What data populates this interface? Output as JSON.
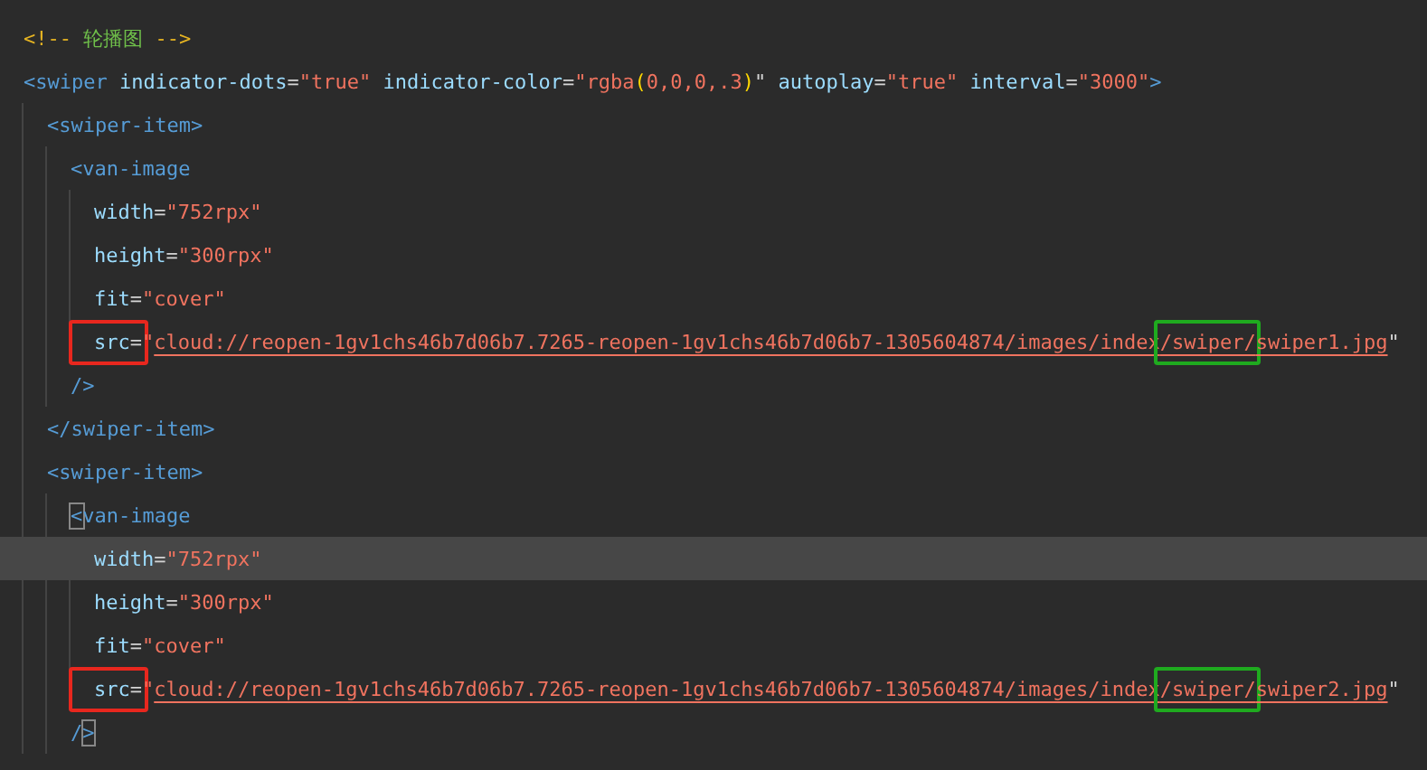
{
  "editor": {
    "lines": [
      {
        "current": false,
        "tokens": [
          {
            "kind": "comment_punct",
            "text": "<!-- "
          },
          {
            "kind": "comment",
            "text": "轮播图"
          },
          {
            "kind": "comment_punct",
            "text": " -->"
          }
        ]
      },
      {
        "current": false,
        "tokens": [
          {
            "kind": "tag",
            "text": "<swiper"
          },
          {
            "kind": "attr",
            "text": " indicator-dots"
          },
          {
            "kind": "punct",
            "text": "="
          },
          {
            "kind": "string",
            "text": "\"true\""
          },
          {
            "kind": "attr",
            "text": " indicator-color"
          },
          {
            "kind": "punct",
            "text": "="
          },
          {
            "kind": "string",
            "text": "\"rgba"
          },
          {
            "kind": "paren",
            "text": "("
          },
          {
            "kind": "string",
            "text": "0,0,0,.3"
          },
          {
            "kind": "paren",
            "text": ")"
          },
          {
            "kind": "punct",
            "text": "\""
          },
          {
            "kind": "attr",
            "text": " autoplay"
          },
          {
            "kind": "punct",
            "text": "="
          },
          {
            "kind": "string",
            "text": "\"true\""
          },
          {
            "kind": "attr",
            "text": " interval"
          },
          {
            "kind": "punct",
            "text": "="
          },
          {
            "kind": "string",
            "text": "\"3000\""
          },
          {
            "kind": "tag",
            "text": ">"
          }
        ],
        "children": [
          {
            "current": false,
            "tokens": [
              {
                "kind": "tag",
                "text": "<swiper-item>"
              }
            ],
            "children": [
              {
                "current": false,
                "tokens": [
                  {
                    "kind": "tag",
                    "text": "<van-image"
                  }
                ],
                "children": [
                  {
                    "current": false,
                    "tokens": [
                      {
                        "kind": "attr",
                        "text": "width"
                      },
                      {
                        "kind": "punct",
                        "text": "="
                      },
                      {
                        "kind": "string",
                        "text": "\"752rpx\""
                      }
                    ]
                  },
                  {
                    "current": false,
                    "tokens": [
                      {
                        "kind": "attr",
                        "text": "height"
                      },
                      {
                        "kind": "punct",
                        "text": "="
                      },
                      {
                        "kind": "string",
                        "text": "\"300rpx\""
                      }
                    ]
                  },
                  {
                    "current": false,
                    "tokens": [
                      {
                        "kind": "attr",
                        "text": "fit"
                      },
                      {
                        "kind": "punct",
                        "text": "="
                      },
                      {
                        "kind": "string",
                        "text": "\"cover\""
                      }
                    ]
                  },
                  {
                    "current": false,
                    "tokens": [
                      {
                        "kind": "annotation",
                        "color": "#e8271e",
                        "tokens": [
                          {
                            "kind": "attr",
                            "text": "src"
                          },
                          {
                            "kind": "punct",
                            "text": "="
                          }
                        ]
                      },
                      {
                        "kind": "string",
                        "text": "\""
                      },
                      {
                        "kind": "link",
                        "text": "cloud://reopen-1gv1chs46b7d06b7.7265-reopen-1gv1chs46b7d06b7-1305604874/images/index"
                      },
                      {
                        "kind": "annotation",
                        "color": "#1faa1f",
                        "tokens": [
                          {
                            "kind": "link",
                            "text": "/swiper/"
                          }
                        ]
                      },
                      {
                        "kind": "link",
                        "text": "swiper1.jpg"
                      },
                      {
                        "kind": "punct",
                        "text": "\""
                      }
                    ]
                  }
                ]
              },
              {
                "current": false,
                "tokens": [
                  {
                    "kind": "tag",
                    "text": "/>"
                  }
                ]
              }
            ]
          },
          {
            "current": false,
            "tokens": [
              {
                "kind": "tag",
                "text": "</swiper-item>"
              }
            ]
          },
          {
            "current": false,
            "tokens": [
              {
                "kind": "tag",
                "text": "<swiper-item>"
              }
            ],
            "children": [
              {
                "current": false,
                "tokens": [
                  {
                    "kind": "matched_bracket",
                    "text": "<"
                  },
                  {
                    "kind": "tag",
                    "text": "van-image"
                  }
                ],
                "children": [
                  {
                    "current": true,
                    "tokens": [
                      {
                        "kind": "attr",
                        "text": "width"
                      },
                      {
                        "kind": "punct",
                        "text": "="
                      },
                      {
                        "kind": "string",
                        "text": "\"752rpx\""
                      }
                    ]
                  },
                  {
                    "current": false,
                    "tokens": [
                      {
                        "kind": "attr",
                        "text": "height"
                      },
                      {
                        "kind": "punct",
                        "text": "="
                      },
                      {
                        "kind": "string",
                        "text": "\"300rpx\""
                      }
                    ]
                  },
                  {
                    "current": false,
                    "tokens": [
                      {
                        "kind": "attr",
                        "text": "fit"
                      },
                      {
                        "kind": "punct",
                        "text": "="
                      },
                      {
                        "kind": "string",
                        "text": "\"cover\""
                      }
                    ]
                  },
                  {
                    "current": false,
                    "tokens": [
                      {
                        "kind": "annotation",
                        "color": "#e8271e",
                        "tokens": [
                          {
                            "kind": "attr",
                            "text": "src"
                          },
                          {
                            "kind": "punct",
                            "text": "="
                          }
                        ]
                      },
                      {
                        "kind": "string",
                        "text": "\""
                      },
                      {
                        "kind": "link",
                        "text": "cloud://reopen-1gv1chs46b7d06b7.7265-reopen-1gv1chs46b7d06b7-1305604874/images/index"
                      },
                      {
                        "kind": "annotation",
                        "color": "#1faa1f",
                        "tokens": [
                          {
                            "kind": "link",
                            "text": "/swiper/"
                          }
                        ]
                      },
                      {
                        "kind": "link",
                        "text": "swiper2.jpg"
                      },
                      {
                        "kind": "punct",
                        "text": "\""
                      }
                    ]
                  }
                ]
              },
              {
                "current": false,
                "tokens": [
                  {
                    "kind": "tag",
                    "text": "/"
                  },
                  {
                    "kind": "matched_bracket",
                    "text": ">"
                  }
                ]
              }
            ]
          }
        ]
      }
    ]
  }
}
